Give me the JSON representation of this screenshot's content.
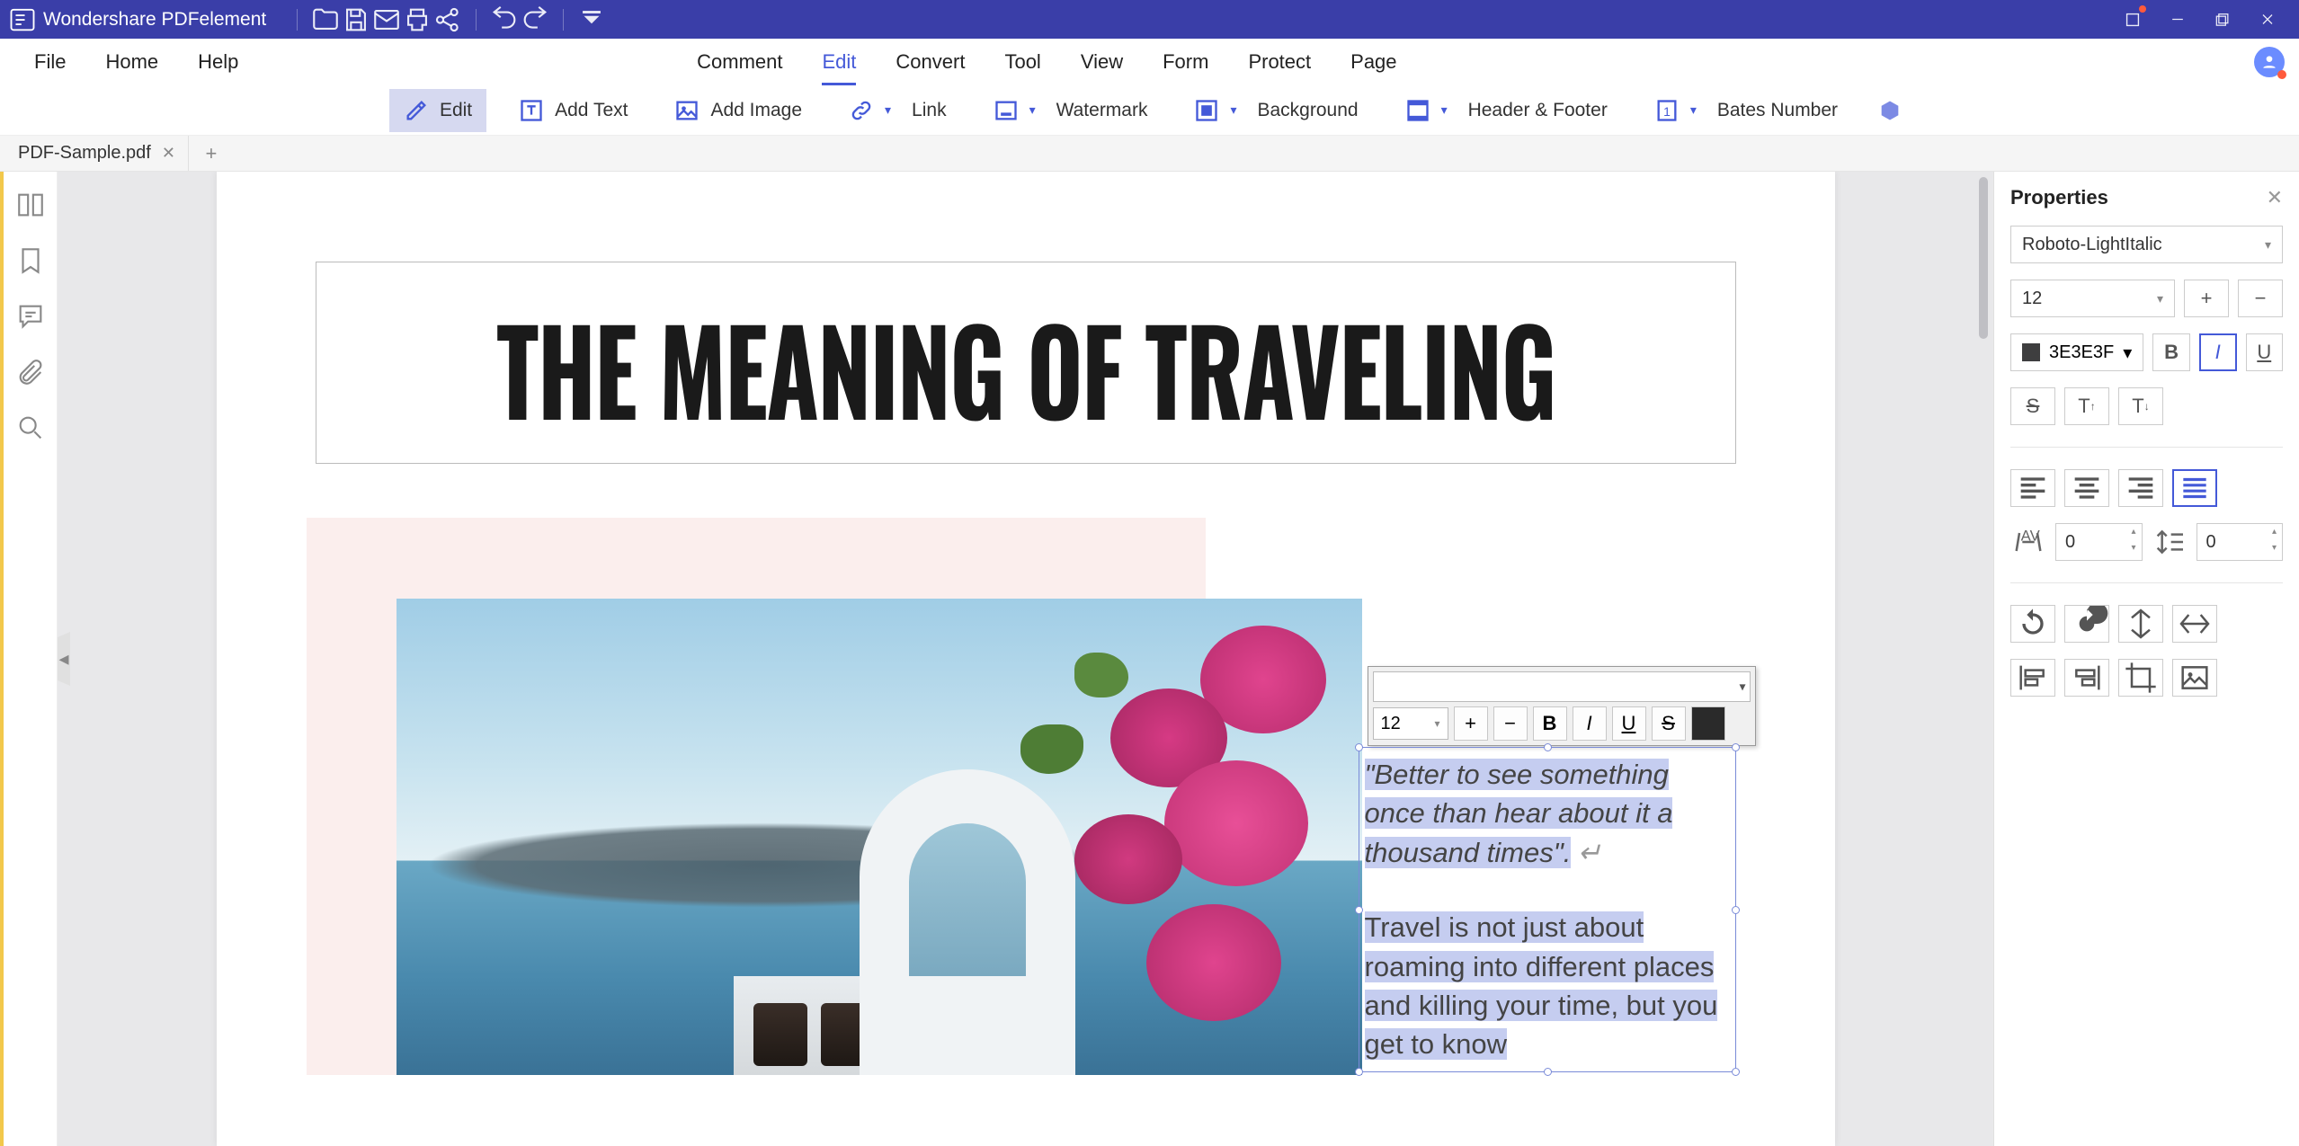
{
  "app": {
    "name": "Wondershare PDFelement"
  },
  "menu": {
    "file": "File",
    "home": "Home",
    "help": "Help",
    "comment": "Comment",
    "edit": "Edit",
    "convert": "Convert",
    "tool": "Tool",
    "view": "View",
    "form": "Form",
    "protect": "Protect",
    "page": "Page",
    "active": "edit"
  },
  "toolbar": {
    "edit": "Edit",
    "addText": "Add Text",
    "addImage": "Add Image",
    "link": "Link",
    "watermark": "Watermark",
    "background": "Background",
    "headerFooter": "Header & Footer",
    "bates": "Bates Number"
  },
  "tabs": {
    "current": "PDF-Sample.pdf"
  },
  "document": {
    "title": "THE MEANING OF TRAVELING",
    "quote": "\"Better to see something once than hear about it a thousand times\".",
    "returnGlyph": "↵",
    "body": "Travel is not just about roaming into different places and killing your time, but you get to know"
  },
  "floatToolbar": {
    "fontSize": "12"
  },
  "properties": {
    "title": "Properties",
    "font": "Roboto-LightItalic",
    "size": "12",
    "color": "3E3E3F",
    "bold": false,
    "italic": true,
    "underline": false,
    "strike": false,
    "align": "justify",
    "charSpacing": "0",
    "lineSpacing": "0"
  }
}
